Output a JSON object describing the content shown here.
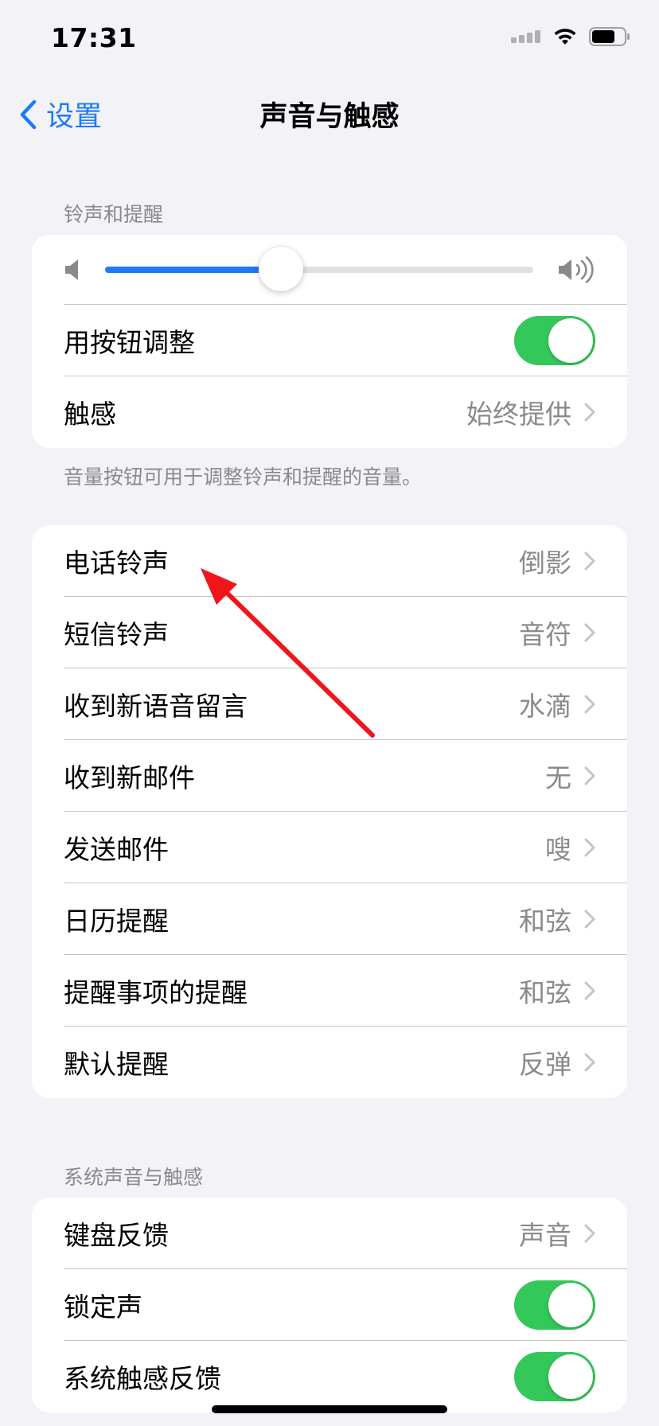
{
  "status_bar": {
    "time": "17:31"
  },
  "nav": {
    "back_label": "设置",
    "title": "声音与触感"
  },
  "ringtone_section": {
    "header": "铃声和提醒",
    "volume_level": 0.41,
    "adjust_with_buttons_label": "用按钮调整",
    "adjust_with_buttons_on": true,
    "haptics_label": "触感",
    "haptics_value": "始终提供",
    "footer": "音量按钮可用于调整铃声和提醒的音量。"
  },
  "sounds_list": [
    {
      "label": "电话铃声",
      "value": "倒影"
    },
    {
      "label": "短信铃声",
      "value": "音符"
    },
    {
      "label": "收到新语音留言",
      "value": "水滴"
    },
    {
      "label": "收到新邮件",
      "value": "无"
    },
    {
      "label": "发送邮件",
      "value": "嗖"
    },
    {
      "label": "日历提醒",
      "value": "和弦"
    },
    {
      "label": "提醒事项的提醒",
      "value": "和弦"
    },
    {
      "label": "默认提醒",
      "value": "反弹"
    }
  ],
  "system_section": {
    "header": "系统声音与触感",
    "keyboard_feedback_label": "键盘反馈",
    "keyboard_feedback_value": "声音",
    "lock_sound_label": "锁定声",
    "lock_sound_on": true,
    "system_haptics_label": "系统触感反馈",
    "system_haptics_on": true
  },
  "colors": {
    "accent": "#1a7cf5",
    "toggle_on": "#34c759",
    "annotation_arrow": "#f0151b",
    "background": "#f2f2f7"
  }
}
